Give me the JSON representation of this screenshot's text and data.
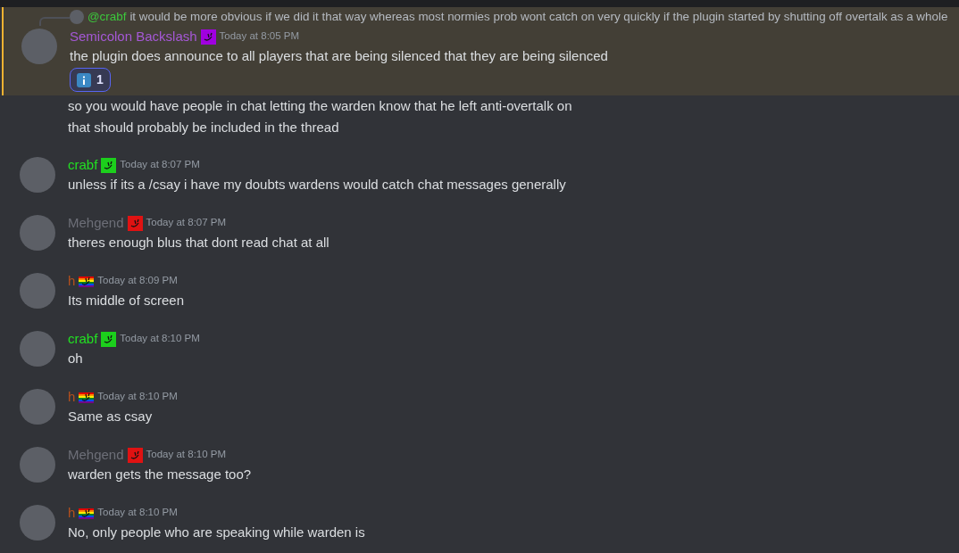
{
  "messages": [
    {
      "kind": "full",
      "highlighted": true,
      "author": {
        "name": "Semicolon Backslash",
        "color": "#a558d6"
      },
      "badge": {
        "kind": "solid",
        "color": "#a000e0"
      },
      "timestamp": "Today at 8:05 PM",
      "reply": {
        "mention": "@crabf",
        "text": "it would be more obvious if we did it that way whereas most normies prob wont catch on very quickly if the plugin started by shutting off overtalk as a whole"
      },
      "text": "the plugin does announce to all players that are being silenced that they are being silenced",
      "reactions": [
        {
          "count": "1",
          "selected": true
        }
      ]
    },
    {
      "kind": "continuation",
      "highlighted": false,
      "text": "so you would have people in chat letting the warden know that he left anti-overtalk on"
    },
    {
      "kind": "continuation",
      "highlighted": false,
      "text": "that should probably be included in the thread"
    },
    {
      "kind": "full",
      "highlighted": false,
      "author": {
        "name": "crabf",
        "color": "#22e022"
      },
      "badge": {
        "kind": "solid",
        "color": "#1ccf1c"
      },
      "timestamp": "Today at 8:07 PM",
      "text": "unless if its a /csay i have my doubts wardens would catch chat messages generally"
    },
    {
      "kind": "full",
      "highlighted": false,
      "author": {
        "name": "Mehgend",
        "color": "#6d6f78"
      },
      "badge": {
        "kind": "solid",
        "color": "#e01212"
      },
      "timestamp": "Today at 8:07 PM",
      "text": "theres enough blus that dont read chat at all"
    },
    {
      "kind": "full",
      "highlighted": false,
      "author": {
        "name": "h",
        "color": "#b5501e"
      },
      "badge": {
        "kind": "rainbow"
      },
      "timestamp": "Today at 8:09 PM",
      "text": "Its middle of screen"
    },
    {
      "kind": "full",
      "highlighted": false,
      "author": {
        "name": "crabf",
        "color": "#22e022"
      },
      "badge": {
        "kind": "solid",
        "color": "#1ccf1c"
      },
      "timestamp": "Today at 8:10 PM",
      "text": "oh"
    },
    {
      "kind": "full",
      "highlighted": false,
      "author": {
        "name": "h",
        "color": "#b5501e"
      },
      "badge": {
        "kind": "rainbow"
      },
      "timestamp": "Today at 8:10 PM",
      "text": "Same as csay"
    },
    {
      "kind": "full",
      "highlighted": false,
      "author": {
        "name": "Mehgend",
        "color": "#6d6f78"
      },
      "badge": {
        "kind": "solid",
        "color": "#e01212"
      },
      "timestamp": "Today at 8:10 PM",
      "text": "warden gets the message too?"
    },
    {
      "kind": "full",
      "highlighted": false,
      "author": {
        "name": "h",
        "color": "#b5501e"
      },
      "badge": {
        "kind": "rainbow"
      },
      "timestamp": "Today at 8:10 PM",
      "text": "No, only people who are speaking while warden is"
    }
  ]
}
